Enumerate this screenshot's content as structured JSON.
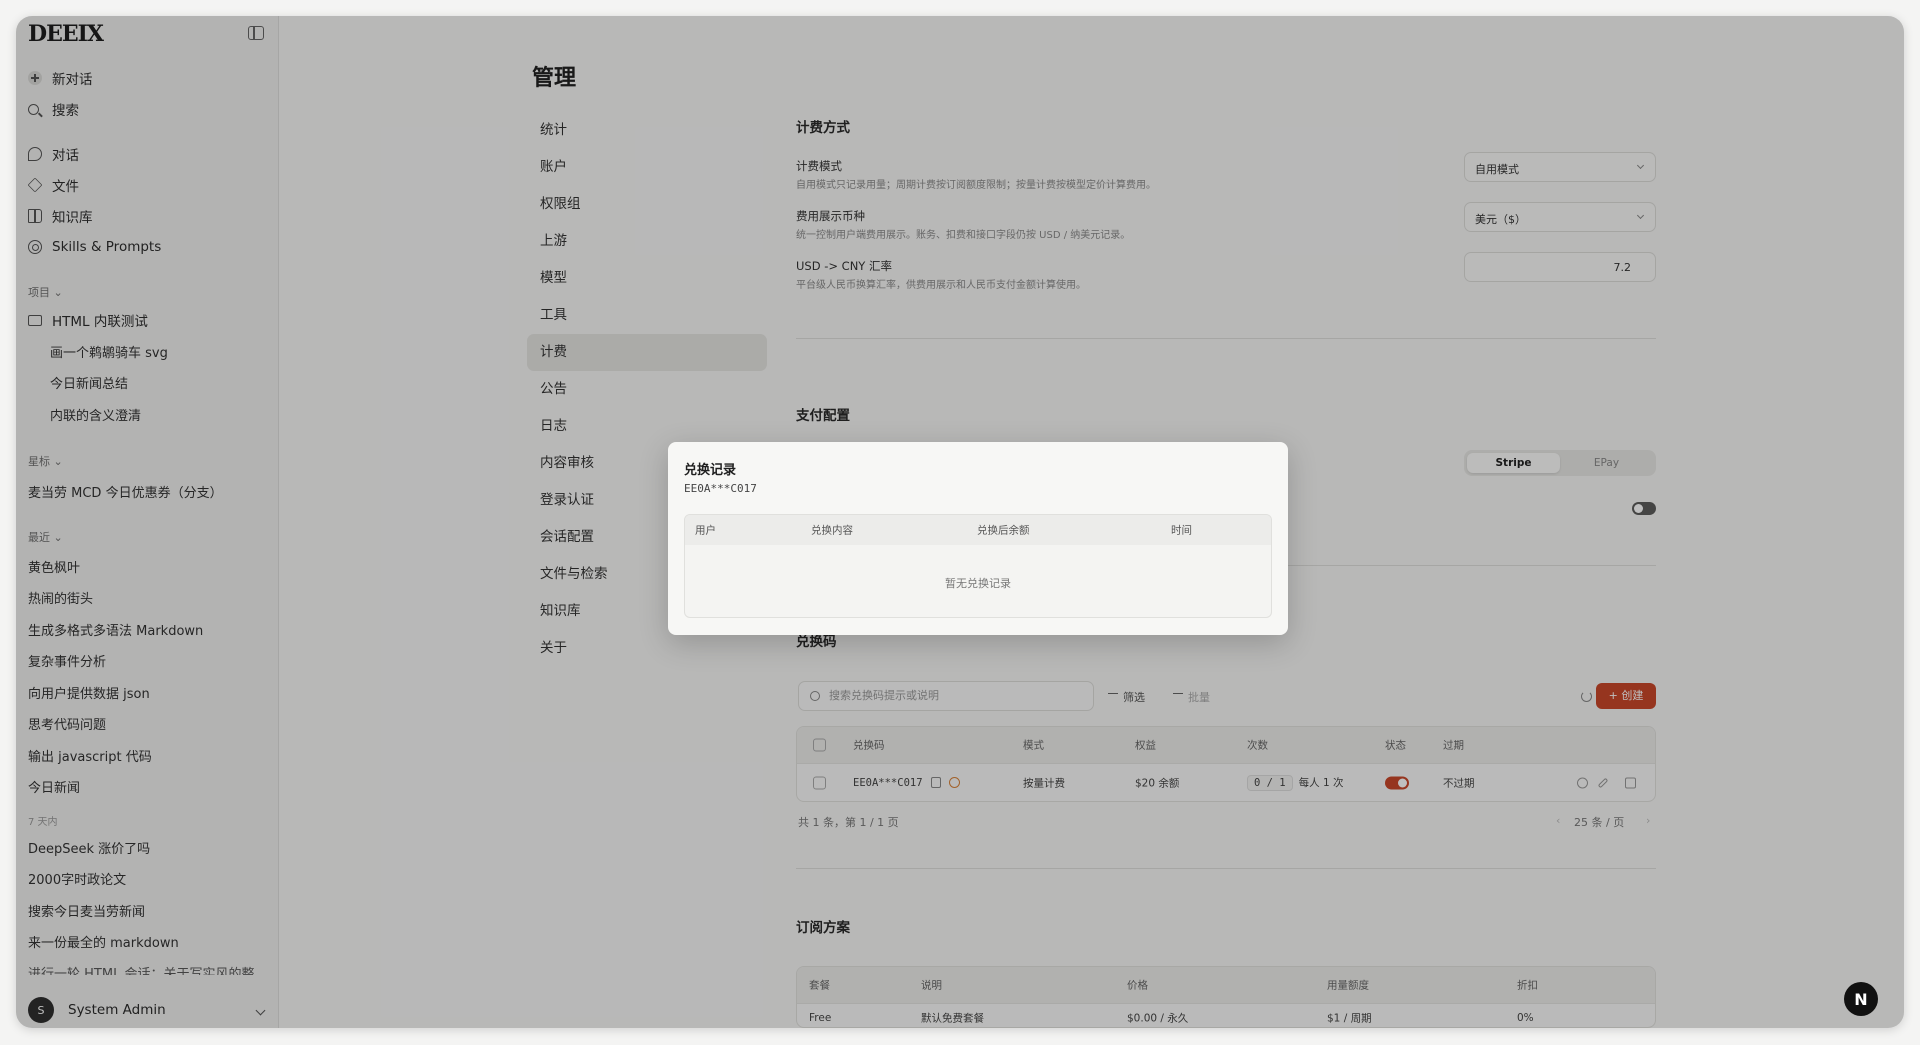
{
  "app": {
    "logo": "DEEIX"
  },
  "sidebar": {
    "new_chat": "新对话",
    "search": "搜索",
    "nav": [
      "对话",
      "文件",
      "知识库",
      "Skills & Prompts"
    ],
    "projects_label": "项目",
    "project_name": "HTML 内联测试",
    "project_items": [
      "画一个鹈鹕骑车 svg",
      "今日新闻总结",
      "内联的含义澄清"
    ],
    "starred_label": "星标",
    "starred_items": [
      "麦当劳 MCD 今日优惠券（分支）"
    ],
    "recent_label": "最近",
    "recent_items": [
      "黄色枫叶",
      "热闹的街头",
      "生成多格式多语法 Markdown",
      "复杂事件分析",
      "向用户提供数据 json",
      "思考代码问题",
      "输出 javascript 代码",
      "今日新闻"
    ],
    "week_label": "7 天内",
    "week_items": [
      "DeepSeek 涨价了吗",
      "2000字时政论文",
      "搜索今日麦当劳新闻",
      "来一份最全的 markdown",
      "进行一轮 HTML 会话：关于写实风的整..."
    ],
    "user": {
      "initial": "S",
      "name": "System Admin"
    }
  },
  "page": {
    "title": "管理",
    "settings_nav": [
      "统计",
      "账户",
      "权限组",
      "上游",
      "模型",
      "工具",
      "计费",
      "公告",
      "日志",
      "内容审核",
      "登录认证",
      "会话配置",
      "文件与检索",
      "知识库",
      "关于"
    ],
    "active_nav": "计费"
  },
  "billing": {
    "title": "计费方式",
    "mode_label": "计费模式",
    "mode_desc": "自用模式只记录用量；周期计费按订阅额度限制；按量计费按模型定价计算费用。",
    "mode_value": "自用模式",
    "currency_label": "费用展示币种",
    "currency_desc": "统一控制用户端费用展示。账务、扣费和接口字段仍按 USD / 纳美元记录。",
    "currency_value": "美元（$）",
    "rate_label": "USD -> CNY 汇率",
    "rate_desc": "平台级人民币换算汇率，供费用展示和人民币支付金额计算使用。",
    "rate_value": "7.2"
  },
  "payment": {
    "title": "支付配置",
    "options": [
      "Stripe",
      "EPay"
    ],
    "selected": "Stripe"
  },
  "redeem": {
    "title": "兑换码",
    "search_placeholder": "搜索兑换码提示或说明",
    "filter": "筛选",
    "batch": "批量",
    "create": "创建",
    "columns": [
      "兑换码",
      "模式",
      "权益",
      "次数",
      "状态",
      "过期"
    ],
    "rows": [
      {
        "code": "EE0A***C017",
        "mode": "按量计费",
        "benefit": "$20 余额",
        "count": "0 / 1",
        "per_user": "每人 1 次",
        "enabled": true,
        "expiry": "不过期"
      }
    ],
    "summary": "共 1 条，第 1 / 1 页",
    "page_size": "25 条 / 页"
  },
  "plans": {
    "title": "订阅方案",
    "columns": [
      "套餐",
      "说明",
      "价格",
      "用量额度",
      "折扣"
    ],
    "rows": [
      {
        "name": "Free",
        "desc": "默认免费套餐",
        "price": "$0.00 / 永久",
        "quota": "$1 / 周期",
        "discount": "0%"
      }
    ]
  },
  "modal": {
    "title": "兑换记录",
    "code": "EE0A***C017",
    "columns": [
      "用户",
      "兑换内容",
      "兑换后余额",
      "时间"
    ],
    "empty": "暂无兑换记录"
  },
  "badge": "N"
}
